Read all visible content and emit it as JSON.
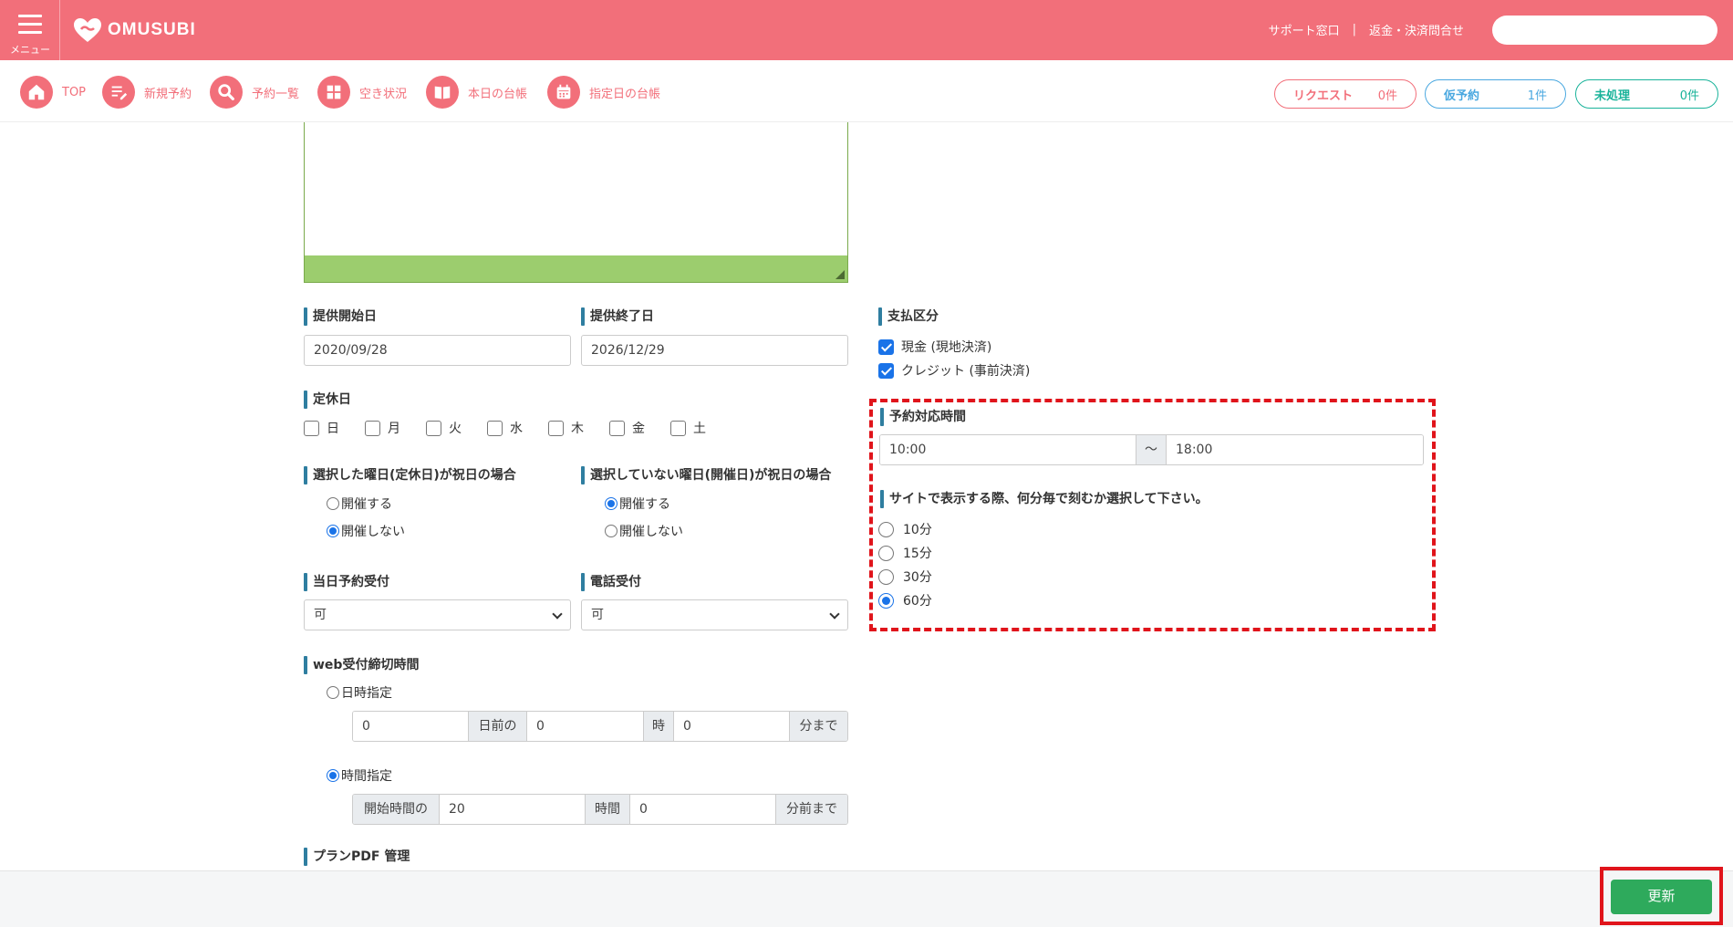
{
  "header": {
    "menu_label": "メニュー",
    "logo_text": "OMUSUBI",
    "link_support": "サポート窓口",
    "link_separator": "|",
    "link_refund": "返金・決済問合せ",
    "search_placeholder": ""
  },
  "nav": {
    "items": [
      {
        "label": "TOP",
        "icon": "home-icon"
      },
      {
        "label": "新規予約",
        "icon": "edit-icon"
      },
      {
        "label": "予約一覧",
        "icon": "search-icon"
      },
      {
        "label": "空き状況",
        "icon": "grid-icon"
      },
      {
        "label": "本日の台帳",
        "icon": "book-icon"
      },
      {
        "label": "指定日の台帳",
        "icon": "calendar-icon"
      }
    ],
    "pills": [
      {
        "label": "リクエスト",
        "count": "0件",
        "color": "#f26f7a"
      },
      {
        "label": "仮予約",
        "count": "1件",
        "color": "#4aa8e0"
      },
      {
        "label": "未処理",
        "count": "0件",
        "color": "#19b39a"
      }
    ]
  },
  "form": {
    "start_date_label": "提供開始日",
    "start_date_value": "2020/09/28",
    "end_date_label": "提供終了日",
    "end_date_value": "2026/12/29",
    "closed_days_label": "定休日",
    "weekdays": [
      "日",
      "月",
      "火",
      "水",
      "木",
      "金",
      "土"
    ],
    "holiday_closed_label": "選択した曜日(定休日)が祝日の場合",
    "holiday_open_label": "選択していない曜日(開催日)が祝日の場合",
    "opt_hold": "開催する",
    "opt_not_hold": "開催しない",
    "same_day_label": "当日予約受付",
    "same_day_value": "可",
    "phone_label": "電話受付",
    "phone_value": "可",
    "web_deadline_label": "web受付締切時間",
    "datetime_option": "日時指定",
    "dt_days_value": "0",
    "dt_days_addon": "日前の",
    "dt_hour_value": "0",
    "dt_hour_addon": "時",
    "dt_min_value": "0",
    "dt_min_addon": "分まで",
    "time_option": "時間指定",
    "t_prefix_addon": "開始時間の",
    "t_hours_value": "20",
    "t_hours_addon": "時間",
    "t_min_value": "0",
    "t_min_addon": "分前まで",
    "pdf_label": "プランPDF 管理",
    "payment_label": "支払区分",
    "payment_cash": "現金 (現地決済)",
    "payment_credit": "クレジット (事前決済)",
    "hours_label": "予約対応時間",
    "hours_from": "10:00",
    "hours_tilde": "〜",
    "hours_to": "18:00",
    "interval_label": "サイトで表示する際、何分毎で刻むか選択して下さい。",
    "intervals": [
      "10分",
      "15分",
      "30分",
      "60分"
    ]
  },
  "footer": {
    "update_label": "更新"
  }
}
